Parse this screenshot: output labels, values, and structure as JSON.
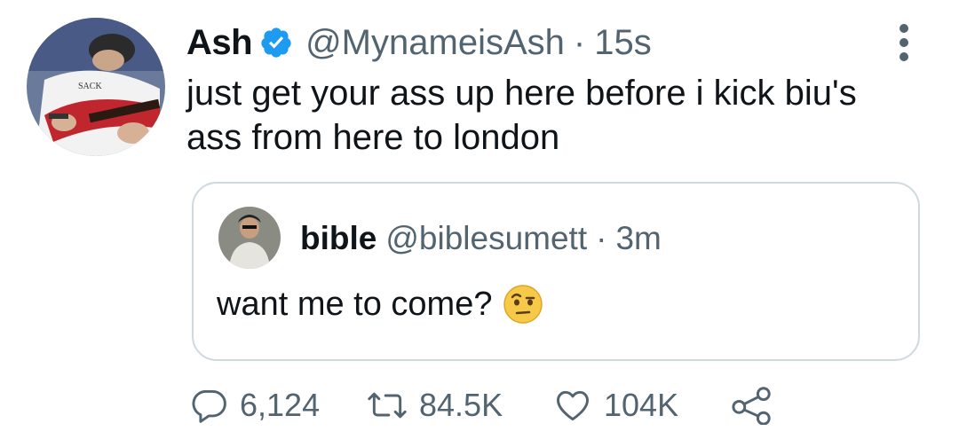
{
  "tweet": {
    "author": {
      "display_name": "Ash",
      "handle": "@MynameisAsh",
      "verified": true
    },
    "separator": "·",
    "time": "15s",
    "text": "just get your ass up here before i kick biu's ass from here to london",
    "more_icon": "more-vertical-icon"
  },
  "quoted_tweet": {
    "author": {
      "display_name": "bible",
      "handle": "@biblesumett"
    },
    "separator": "·",
    "time": "3m",
    "text": "want me to come?",
    "emoji": "face-with-raised-eyebrow"
  },
  "actions": {
    "reply": {
      "icon": "reply-icon",
      "count": "6,124"
    },
    "retweet": {
      "icon": "retweet-icon",
      "count": "84.5K"
    },
    "like": {
      "icon": "heart-icon",
      "count": "104K"
    },
    "share": {
      "icon": "share-icon"
    }
  },
  "colors": {
    "text_primary": "#0f1419",
    "text_secondary": "#536471",
    "verified_blue": "#1d9bf0",
    "border": "#cfd9de"
  }
}
